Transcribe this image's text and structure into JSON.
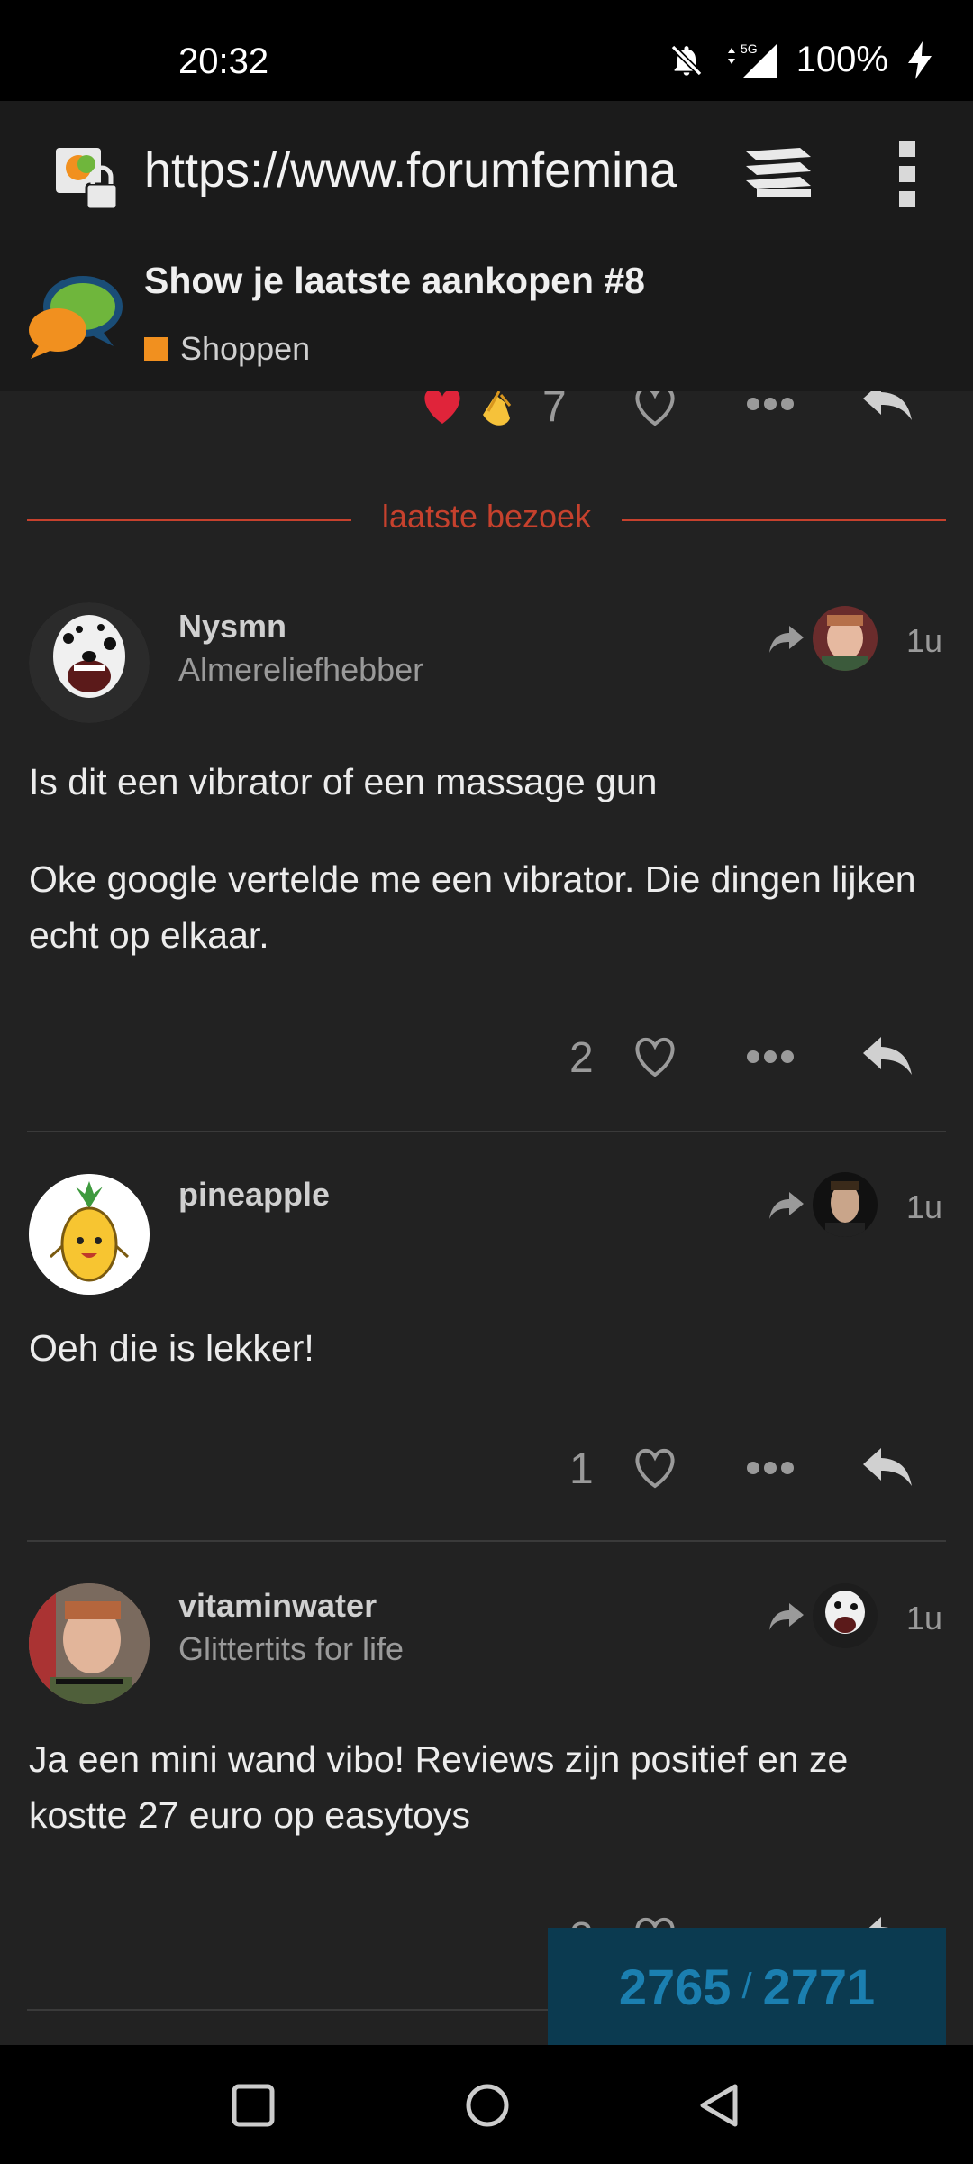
{
  "status_bar": {
    "time": "20:32",
    "network": "5G",
    "battery": "100%"
  },
  "browser": {
    "url": "https://www.forumfemina",
    "icons": [
      "site-lock-icon",
      "tabs-icon",
      "overflow-menu-icon"
    ]
  },
  "topic": {
    "title": "Show je laatste aankopen #8",
    "category": "Shoppen",
    "category_color": "#f1901f"
  },
  "previous_post": {
    "reactions": [
      "heart-emoji",
      "clapping-emoji"
    ],
    "count": "7"
  },
  "divider_label": "laatste bezoek",
  "posts": [
    {
      "username": "Nysmn",
      "user_title": "Almereliefhebber",
      "time_ago": "1u",
      "paragraphs": [
        "Is dit een vibrator of een massage gun",
        "Oke google vertelde me een vibrator. Die dingen lijken echt op elkaar."
      ],
      "likes": "2"
    },
    {
      "username": "pineapple",
      "user_title": "",
      "time_ago": "1u",
      "paragraphs": [
        "Oeh die is lekker!"
      ],
      "likes": "1"
    },
    {
      "username": "vitaminwater",
      "user_title": "Glittertits for life",
      "time_ago": "1u",
      "paragraphs": [
        "Ja een mini wand vibo! Reviews zijn positief en ze kostte 27 euro op easytoys"
      ],
      "likes": "2"
    }
  ],
  "progress": {
    "current": "2765",
    "separator": "/",
    "total": "2771"
  },
  "accent_color": "#c6412d"
}
